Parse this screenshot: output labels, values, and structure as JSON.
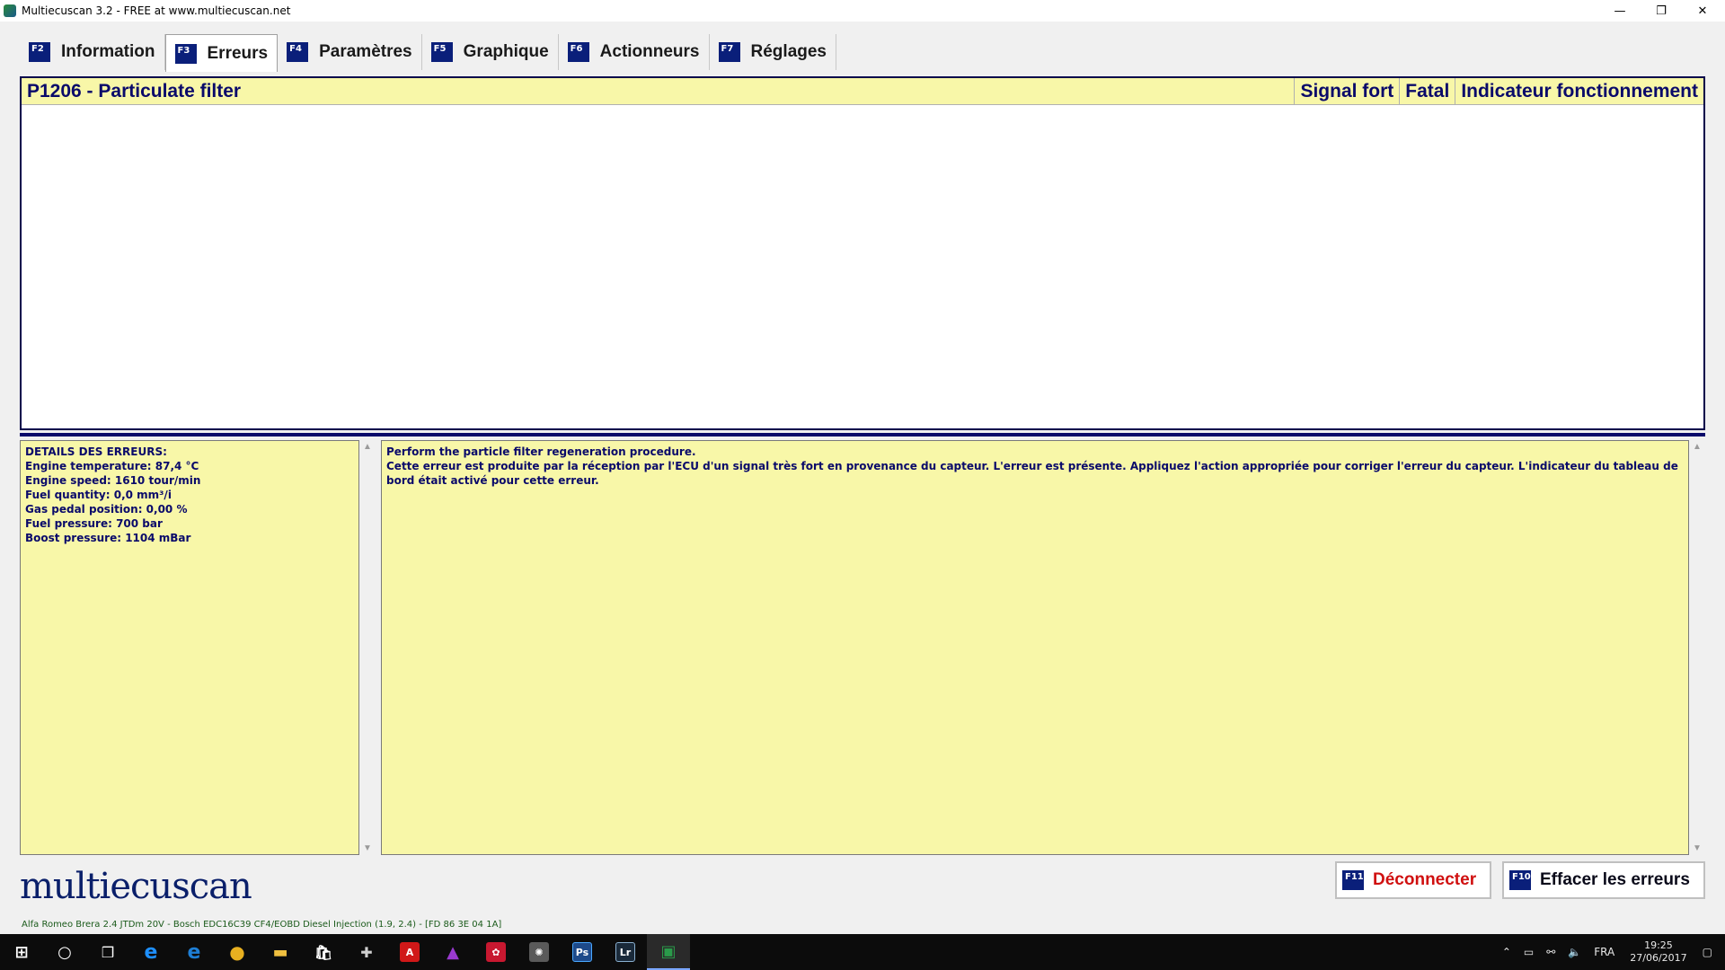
{
  "window": {
    "title": "Multiecuscan 3.2 - FREE at www.multiecuscan.net",
    "minimize": "—",
    "restore": "❐",
    "close": "✕"
  },
  "tabs": [
    {
      "key": "F2",
      "label": "Information"
    },
    {
      "key": "F3",
      "label": "Erreurs",
      "active": true
    },
    {
      "key": "F4",
      "label": "Paramètres"
    },
    {
      "key": "F5",
      "label": "Graphique"
    },
    {
      "key": "F6",
      "label": "Actionneurs"
    },
    {
      "key": "F7",
      "label": "Réglages"
    }
  ],
  "error_table": {
    "headers": [
      "P1206 - Particulate filter",
      "Signal fort",
      "Fatal",
      "Indicateur fonctionnement"
    ],
    "rows": []
  },
  "details": {
    "title": "DETAILS DES ERREURS:",
    "lines": [
      "Engine temperature: 87,4 °C",
      "Engine speed: 1610 tour/min",
      "Fuel quantity: 0,0 mm³/i",
      "Gas pedal position: 0,00 %",
      "Fuel pressure: 700 bar",
      "Boost pressure: 1104 mBar"
    ]
  },
  "description": {
    "lines": [
      "Perform the particle filter regeneration procedure.",
      "Cette erreur est produite par la réception par l'ECU d'un signal très fort en provenance du capteur. L'erreur est présente. Appliquez l'action appropriée pour corriger l'erreur du capteur. L'indicateur du tableau de bord était activé pour cette erreur."
    ]
  },
  "logo": "multiecuscan",
  "buttons": {
    "disconnect": {
      "key": "F11",
      "label": "Déconnecter",
      "color": "#d01010"
    },
    "clear_errors": {
      "key": "F10",
      "label": "Effacer les erreurs",
      "color": "#0a0a1a"
    }
  },
  "status": "Alfa Romeo Brera 2.4 JTDm 20V - Bosch EDC16C39 CF4/EOBD Diesel Injection (1.9, 2.4) - [FD 86 3E 04 1A]",
  "taskbar": {
    "apps": [
      {
        "name": "start",
        "glyph": "⊞",
        "color": "#ffffff"
      },
      {
        "name": "search",
        "glyph": "○",
        "color": "#ffffff"
      },
      {
        "name": "task-view",
        "glyph": "❒",
        "color": "#ffffff"
      },
      {
        "name": "internet-explorer",
        "glyph": "e",
        "color": "#1e90ff"
      },
      {
        "name": "edge",
        "glyph": "e",
        "color": "#1e7fd6"
      },
      {
        "name": "chrome",
        "glyph": "●",
        "color": "#e8b020"
      },
      {
        "name": "file-explorer",
        "glyph": "▬",
        "color": "#f0c040"
      },
      {
        "name": "store",
        "glyph": "🛍",
        "color": "#ffffff"
      },
      {
        "name": "app-tools",
        "glyph": "✚",
        "color": "#d0d0d0"
      },
      {
        "name": "acrobat",
        "glyph": "A",
        "color": "#d01818"
      },
      {
        "name": "app-prism",
        "glyph": "▲",
        "color": "#9a3ad0"
      },
      {
        "name": "app-red",
        "glyph": "✿",
        "color": "#c81830"
      },
      {
        "name": "app-gray",
        "glyph": "✺",
        "color": "#8a8a8a"
      },
      {
        "name": "photoshop",
        "glyph": "Ps",
        "color": "#1e4a8a"
      },
      {
        "name": "lightroom",
        "glyph": "Lr",
        "color": "#2a4a6a"
      },
      {
        "name": "multiecuscan",
        "glyph": "▣",
        "color": "#2a9a4a",
        "active": true
      }
    ],
    "tray": {
      "lang": "FRA",
      "time": "19:25",
      "date": "27/06/2017"
    }
  }
}
